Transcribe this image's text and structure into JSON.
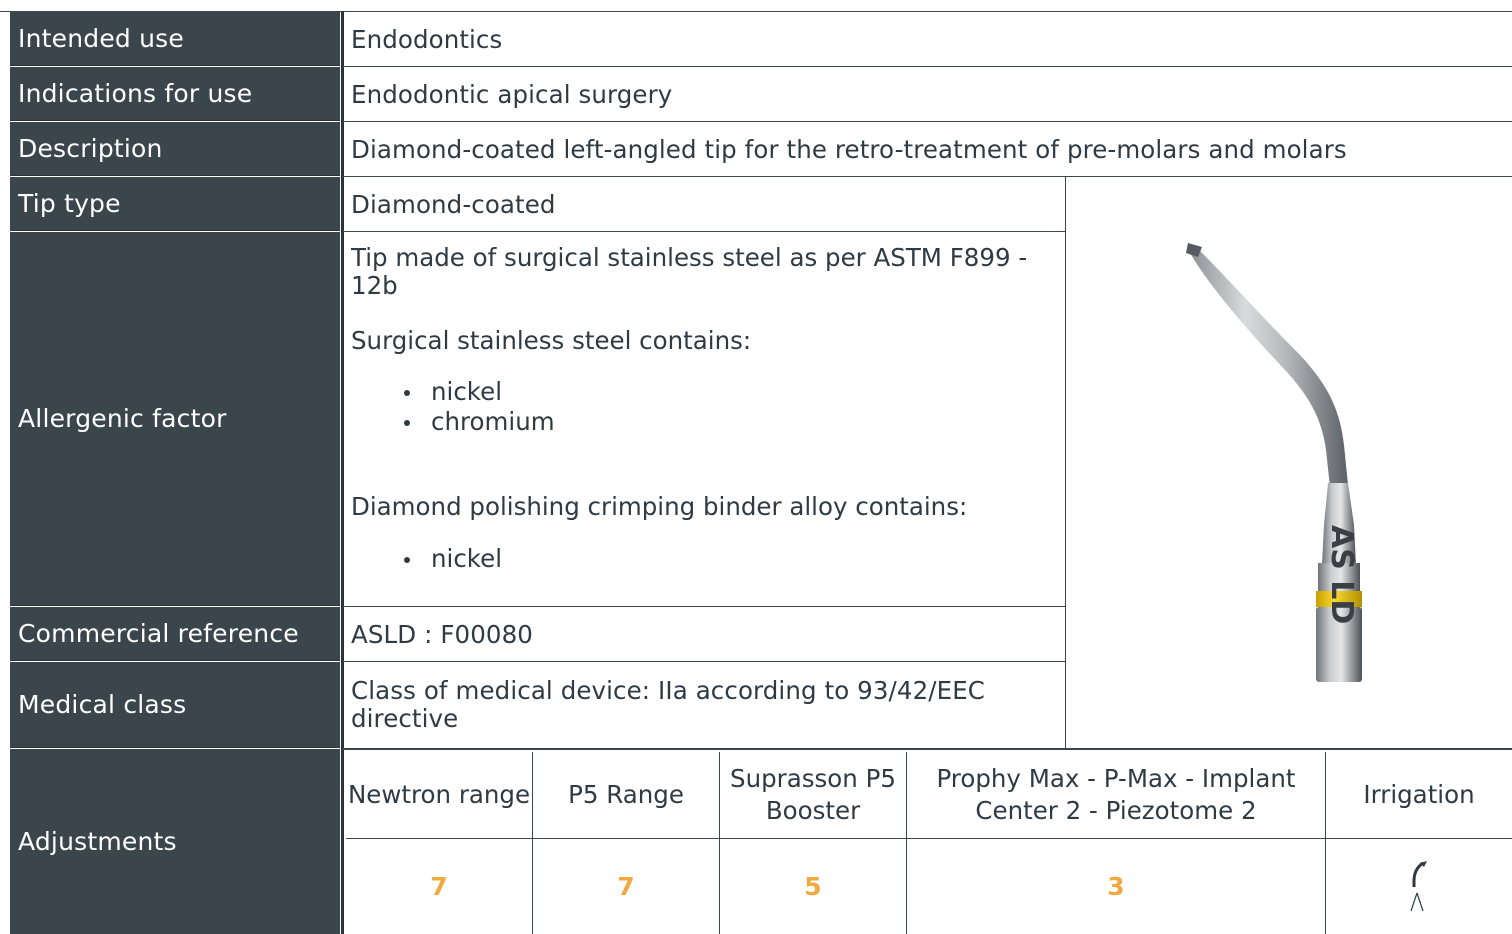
{
  "rows": {
    "intended_use": {
      "label": "Intended use",
      "value": "Endodontics"
    },
    "indications": {
      "label": "Indications for use",
      "value": "Endodontic apical surgery"
    },
    "description": {
      "label": "Description",
      "value": "Diamond-coated left-angled tip for the retro-treatment of pre-molars and molars"
    },
    "tip_type": {
      "label": "Tip type",
      "value": "Diamond-coated"
    },
    "allergenic": {
      "label": "Allergenic factor",
      "text1": "Tip made of surgical stainless steel as per ASTM F899 - 12b",
      "text2": "Surgical stainless steel contains:",
      "list1": [
        "nickel",
        "chromium"
      ],
      "text3": "Diamond polishing crimping binder alloy contains:",
      "list2": [
        "nickel"
      ]
    },
    "commercial": {
      "label": "Commercial reference",
      "value": "ASLD : F00080"
    },
    "medical_class": {
      "label": "Medical class",
      "value": "Class of medical device: IIa according to 93/42/EEC directive"
    }
  },
  "adjustments": {
    "label": "Adjustments",
    "columns": [
      {
        "header": "Newtron range",
        "value": "7"
      },
      {
        "header": "P5 Range",
        "value": "7"
      },
      {
        "header": "Suprasson P5 Booster",
        "value": "5"
      },
      {
        "header": "Prophy Max - P-Max - Implant Center 2 - Piezotome 2",
        "value": "3"
      },
      {
        "header": "Irrigation",
        "value": ""
      }
    ],
    "irrigation_icon": "irrigation-icon"
  },
  "image": {
    "tip_engraving": "AS LD",
    "band_color": "#f0c419"
  },
  "colors": {
    "label_bg": "#3a454c",
    "value_accent": "#f2a840"
  }
}
